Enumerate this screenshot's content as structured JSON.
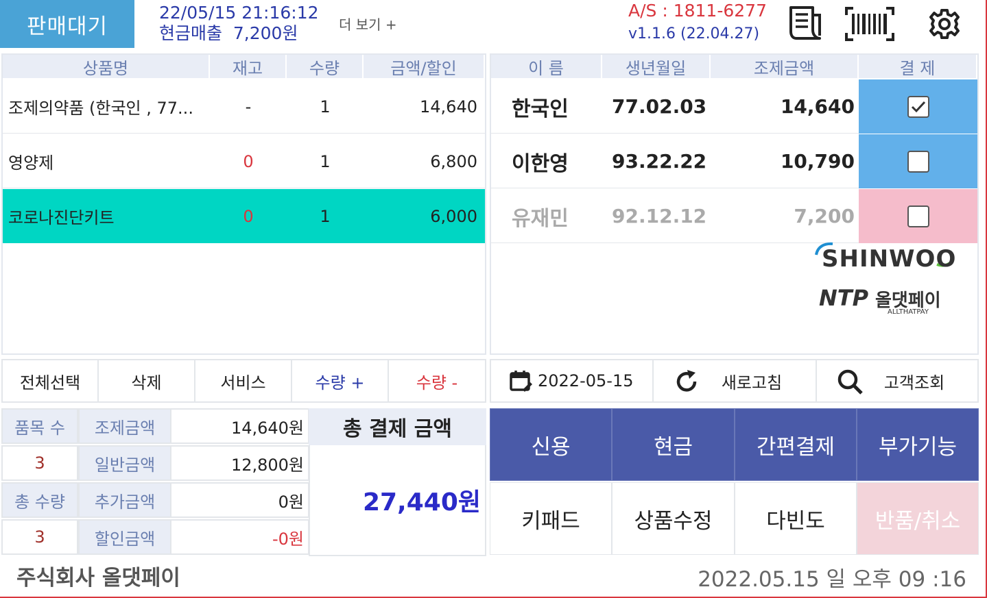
{
  "header": {
    "status": "판매대기",
    "datetime": "22/05/15 21:16:12",
    "cash_sales": "현금매출  7,200원",
    "more_label": "더 보기 +",
    "as_phone": "A/S : 1811-6277",
    "version": "v1.1.6 (22.04.27)",
    "icons": [
      "receipt-icon",
      "barcode-icon",
      "gear-icon"
    ]
  },
  "items_table": {
    "headers": [
      "상품명",
      "재고",
      "수량",
      "금액/할인"
    ],
    "rows": [
      {
        "name": "조제의약품 (한국인 , 77...",
        "stock": "-",
        "qty": "1",
        "amount": "14,640"
      },
      {
        "name": "영양제",
        "stock": "0",
        "qty": "1",
        "amount": "6,800"
      },
      {
        "name": "코로나진단키트",
        "stock": "0",
        "qty": "1",
        "amount": "6,000"
      }
    ]
  },
  "patients_table": {
    "headers": [
      "이 름",
      "생년월일",
      "조제금액",
      "결 제"
    ],
    "rows": [
      {
        "name": "한국인",
        "birth": "77.02.03",
        "amount": "14,640",
        "checked": true
      },
      {
        "name": "이한영",
        "birth": "93.22.22",
        "amount": "10,790",
        "checked": false
      },
      {
        "name": "유재민",
        "birth": "92.12.12",
        "amount": "7,200",
        "checked": false
      }
    ],
    "logo_main": "SHINWOO",
    "logo_sub": "올댓페이",
    "logo_mark": "NTP",
    "logo_caption": "ALLTHATPAY"
  },
  "item_actions": {
    "select_all": "전체선택",
    "delete": "삭제",
    "service": "서비스",
    "qty_plus": "수량 +",
    "qty_minus": "수량 -"
  },
  "patient_actions": {
    "date": "2022-05-15",
    "refresh": "새로고침",
    "lookup": "고객조회"
  },
  "summary": {
    "item_count_label": "품목 수",
    "item_count": "3",
    "total_qty_label": "총 수량",
    "total_qty": "3",
    "rx_amount_label": "조제금액",
    "rx_amount": "14,640원",
    "general_amount_label": "일반금액",
    "general_amount": "12,800원",
    "extra_amount_label": "추가금액",
    "extra_amount": "0원",
    "discount_amount_label": "할인금액",
    "discount_amount": "-0원",
    "total_label": "총 결제 금액",
    "total": "27,440원"
  },
  "payment_buttons": {
    "credit": "신용",
    "cash": "현금",
    "easy_pay": "간편결제",
    "extra": "부가기능",
    "keypad": "키패드",
    "edit_item": "상품수정",
    "frequent": "다빈도",
    "refund": "반품/취소"
  },
  "footer": {
    "company": "주식회사 올댓페이",
    "datetime": "2022.05.15 일  오후 09 :16"
  },
  "colors": {
    "accent_blue": "#4aa3d6",
    "selected_row": "#00d6c3",
    "pay_blue": "#4a5aa8",
    "checked_cell": "#62b0ea",
    "unpaid_cell": "#f5bccb"
  }
}
